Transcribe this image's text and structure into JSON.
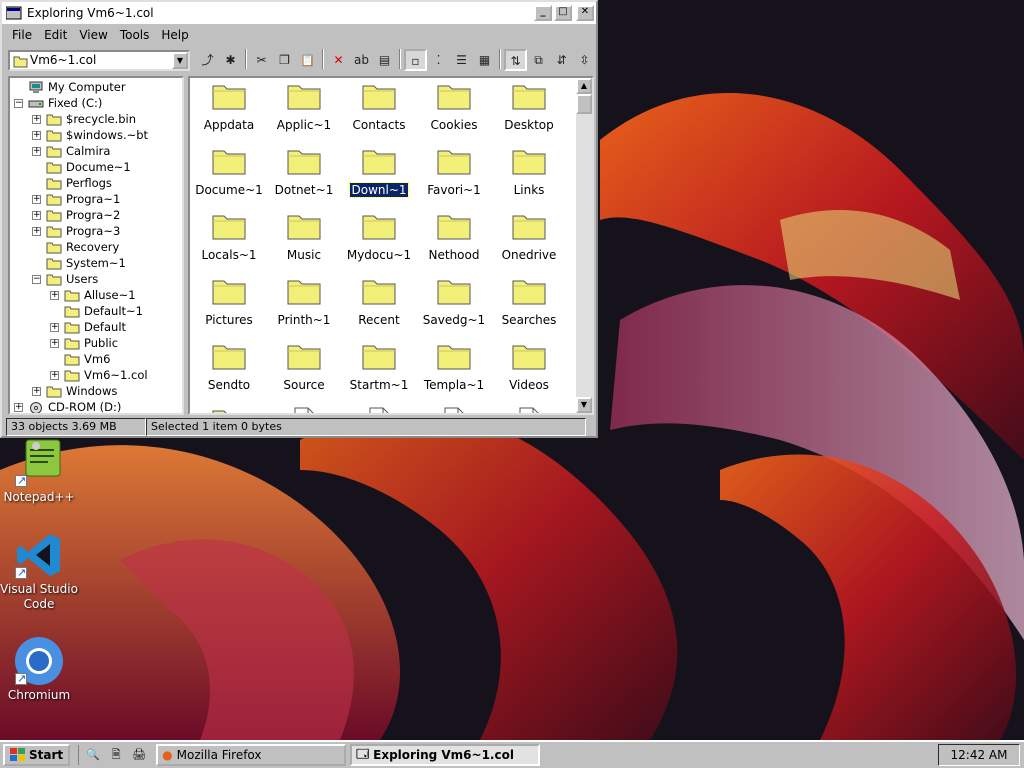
{
  "window": {
    "title": "Exploring Vm6~1.col",
    "menu": [
      "File",
      "Edit",
      "View",
      "Tools",
      "Help"
    ],
    "address_value": "Vm6~1.col"
  },
  "toolbar": {
    "buttons": [
      "up-folder-icon",
      "map-drive-icon",
      "cut-icon",
      "copy-icon",
      "paste-icon",
      "delete-icon",
      "rename-icon",
      "properties-icon",
      "large-icons-view-icon",
      "small-icons-view-icon",
      "list-view-icon",
      "details-view-icon",
      "sort-name-icon",
      "sort-type-icon",
      "sort-size-icon",
      "sort-date-icon"
    ]
  },
  "tree": {
    "items": [
      {
        "label": "My Computer",
        "level": 0,
        "expander": "",
        "icon": "computer-icon"
      },
      {
        "label": "Fixed (C:)",
        "level": 0,
        "expander": "−",
        "icon": "drive-icon"
      },
      {
        "label": "$recycle.bin",
        "level": 1,
        "expander": "+",
        "icon": "folder-icon"
      },
      {
        "label": "$windows.~bt",
        "level": 1,
        "expander": "+",
        "icon": "folder-icon"
      },
      {
        "label": "Calmira",
        "level": 1,
        "expander": "+",
        "icon": "folder-icon"
      },
      {
        "label": "Docume~1",
        "level": 1,
        "expander": "",
        "icon": "folder-icon"
      },
      {
        "label": "Perflogs",
        "level": 1,
        "expander": "",
        "icon": "folder-icon"
      },
      {
        "label": "Progra~1",
        "level": 1,
        "expander": "+",
        "icon": "folder-icon"
      },
      {
        "label": "Progra~2",
        "level": 1,
        "expander": "+",
        "icon": "folder-icon"
      },
      {
        "label": "Progra~3",
        "level": 1,
        "expander": "+",
        "icon": "folder-icon"
      },
      {
        "label": "Recovery",
        "level": 1,
        "expander": "",
        "icon": "folder-icon"
      },
      {
        "label": "System~1",
        "level": 1,
        "expander": "",
        "icon": "folder-icon"
      },
      {
        "label": "Users",
        "level": 1,
        "expander": "−",
        "icon": "folder-icon"
      },
      {
        "label": "Alluse~1",
        "level": 2,
        "expander": "+",
        "icon": "folder-icon"
      },
      {
        "label": "Default~1",
        "level": 2,
        "expander": "",
        "icon": "folder-icon"
      },
      {
        "label": "Default",
        "level": 2,
        "expander": "+",
        "icon": "folder-icon"
      },
      {
        "label": "Public",
        "level": 2,
        "expander": "+",
        "icon": "folder-icon"
      },
      {
        "label": "Vm6",
        "level": 2,
        "expander": "",
        "icon": "folder-icon"
      },
      {
        "label": "Vm6~1.col",
        "level": 2,
        "expander": "+",
        "icon": "open-folder-icon"
      },
      {
        "label": "Windows",
        "level": 1,
        "expander": "+",
        "icon": "folder-icon"
      },
      {
        "label": "CD-ROM (D:)",
        "level": 0,
        "expander": "+",
        "icon": "cdrom-icon"
      }
    ]
  },
  "files": {
    "items": [
      {
        "label": "Appdata",
        "type": "folder"
      },
      {
        "label": "Applic~1",
        "type": "folder"
      },
      {
        "label": "Contacts",
        "type": "folder"
      },
      {
        "label": "Cookies",
        "type": "folder"
      },
      {
        "label": "Desktop",
        "type": "folder"
      },
      {
        "label": "Docume~1",
        "type": "folder"
      },
      {
        "label": "Dotnet~1",
        "type": "folder"
      },
      {
        "label": "Downl~1",
        "type": "folder",
        "selected": true
      },
      {
        "label": "Favori~1",
        "type": "folder"
      },
      {
        "label": "Links",
        "type": "folder"
      },
      {
        "label": "Locals~1",
        "type": "folder"
      },
      {
        "label": "Music",
        "type": "folder"
      },
      {
        "label": "Mydocu~1",
        "type": "folder"
      },
      {
        "label": "Nethood",
        "type": "folder"
      },
      {
        "label": "Onedrive",
        "type": "folder"
      },
      {
        "label": "Pictures",
        "type": "folder"
      },
      {
        "label": "Printh~1",
        "type": "folder"
      },
      {
        "label": "Recent",
        "type": "folder"
      },
      {
        "label": "Savedg~1",
        "type": "folder"
      },
      {
        "label": "Searches",
        "type": "folder"
      },
      {
        "label": "Sendto",
        "type": "folder"
      },
      {
        "label": "Source",
        "type": "folder"
      },
      {
        "label": "Startm~1",
        "type": "folder"
      },
      {
        "label": "Templa~1",
        "type": "folder"
      },
      {
        "label": "Videos",
        "type": "folder"
      },
      {
        "label": "",
        "type": "folder"
      },
      {
        "label": "",
        "type": "file"
      },
      {
        "label": "",
        "type": "file"
      },
      {
        "label": "",
        "type": "file"
      },
      {
        "label": "",
        "type": "file"
      }
    ]
  },
  "status": {
    "objects": "33 objects  3.69 MB",
    "selection": "Selected 1 item  0 bytes"
  },
  "desktop": {
    "icons": [
      {
        "label": "Notepad++",
        "icon": "notepadpp-icon"
      },
      {
        "label": "Visual Studio Code",
        "icon": "vscode-icon"
      },
      {
        "label": "Chromium",
        "icon": "chromium-icon"
      }
    ]
  },
  "taskbar": {
    "start_label": "Start",
    "quicklaunch": [
      "explorer-icon",
      "find-icon",
      "run-icon"
    ],
    "tasks": [
      {
        "label": "Mozilla Firefox",
        "icon": "firefox-icon",
        "active": false
      },
      {
        "label": "Exploring Vm6~1.col",
        "icon": "explorer-icon",
        "active": true
      }
    ],
    "clock": "12:42 AM"
  },
  "colors": {
    "folder_yellow": "#f3f07a",
    "selection": "#0a246a",
    "chrome": "#c0c0c0"
  }
}
